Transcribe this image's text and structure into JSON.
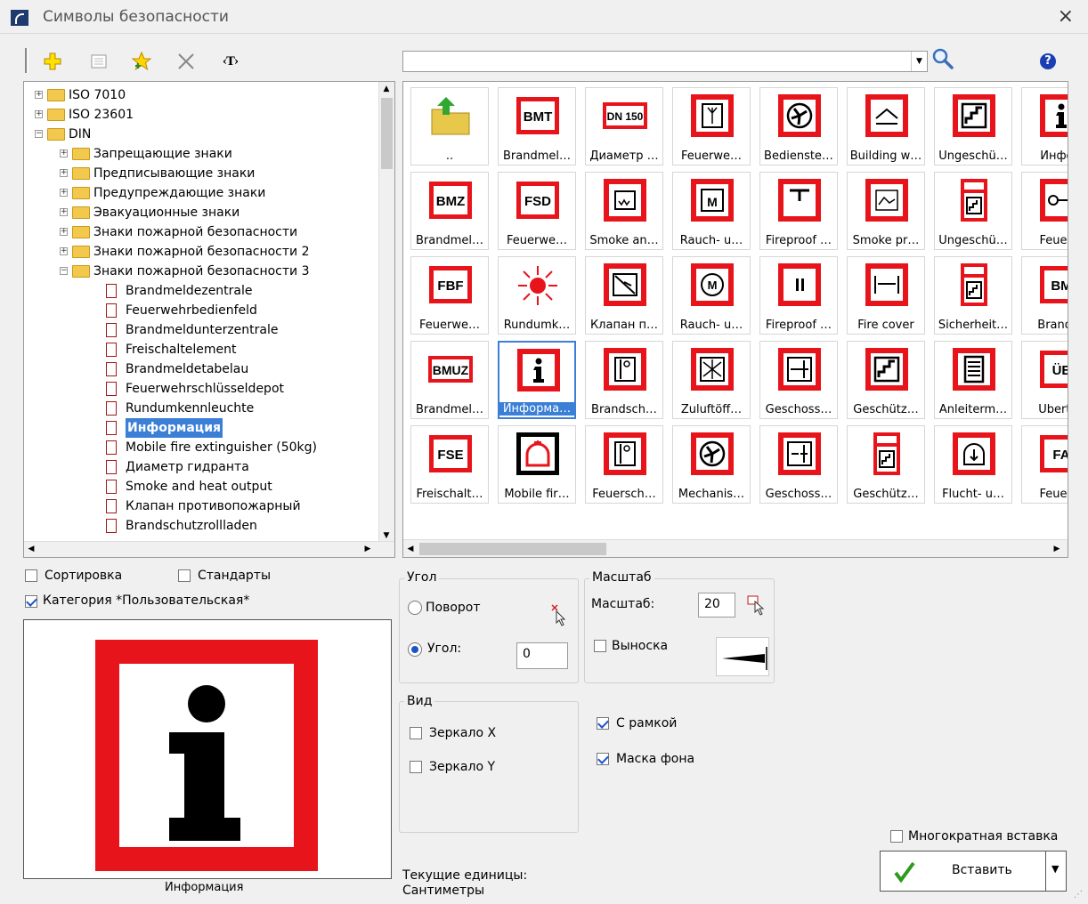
{
  "window": {
    "title": "Символы безопасности",
    "close": "×"
  },
  "toolbar": {
    "text_label": "‹T›",
    "search_value": "",
    "help": "?"
  },
  "tree": {
    "rows": [
      {
        "label": "ISO 7010",
        "expander": "+",
        "type": "folder",
        "level": 0
      },
      {
        "label": "ISO 23601",
        "expander": "+",
        "type": "folder",
        "level": 0
      },
      {
        "label": "DIN",
        "expander": "−",
        "type": "folder",
        "level": 0
      },
      {
        "label": "Запрещающие знаки",
        "expander": "+",
        "type": "folder",
        "level": 1
      },
      {
        "label": "Предписывающие знаки",
        "expander": "+",
        "type": "folder",
        "level": 1
      },
      {
        "label": "Предупреждающие знаки",
        "expander": "+",
        "type": "folder",
        "level": 1
      },
      {
        "label": "Эвакуационные знаки",
        "expander": "+",
        "type": "folder",
        "level": 1
      },
      {
        "label": "Знаки пожарной безопасности",
        "expander": "+",
        "type": "folder",
        "level": 1
      },
      {
        "label": "Знаки пожарной безопасности 2",
        "expander": "+",
        "type": "folder",
        "level": 1
      },
      {
        "label": "Знаки пожарной безопасности 3",
        "expander": "−",
        "type": "folder",
        "level": 1
      },
      {
        "label": "Brandmeldezentrale",
        "type": "doc",
        "level": 2
      },
      {
        "label": "Feuerwehrbedienfeld",
        "type": "doc",
        "level": 2
      },
      {
        "label": "Brandmeldunterzentrale",
        "type": "doc",
        "level": 2
      },
      {
        "label": "Freischaltelement",
        "type": "doc",
        "level": 2
      },
      {
        "label": "Brandmeldetabelau",
        "type": "doc",
        "level": 2
      },
      {
        "label": "Feuerwehrschlüsseldepot",
        "type": "doc",
        "level": 2
      },
      {
        "label": "Rundumkennleuchte",
        "type": "doc",
        "level": 2
      },
      {
        "label": "Информация",
        "type": "doc",
        "level": 2,
        "selected": true
      },
      {
        "label": "Mobile fire extinguisher (50kg)",
        "type": "doc",
        "level": 2
      },
      {
        "label": "Диаметр гидранта",
        "type": "doc",
        "level": 2
      },
      {
        "label": "Smoke and heat output",
        "type": "doc",
        "level": 2
      },
      {
        "label": "Клапан противопожарный",
        "type": "doc",
        "level": 2
      },
      {
        "label": "Brandschutzrollladen",
        "type": "doc",
        "level": 2
      }
    ]
  },
  "grid": {
    "rows": [
      [
        {
          "caption": "..",
          "glyph": "up-folder"
        },
        {
          "caption": "Brandmel…",
          "glyph": "BMT"
        },
        {
          "caption": "Диаметр …",
          "glyph": "DN 150"
        },
        {
          "caption": "Feuerwe…",
          "glyph": "antenna"
        },
        {
          "caption": "Bedienste…",
          "glyph": "fan"
        },
        {
          "caption": "Building w…",
          "glyph": "roof"
        },
        {
          "caption": "Ungeschü…",
          "glyph": "stairs"
        },
        {
          "caption": "Инфор",
          "glyph": "i"
        }
      ],
      [
        {
          "caption": "Brandmel…",
          "glyph": "BMZ"
        },
        {
          "caption": "Feuerwe…",
          "glyph": "FSD"
        },
        {
          "caption": "Smoke an…",
          "glyph": "smoke"
        },
        {
          "caption": "Rauch- u…",
          "glyph": "M"
        },
        {
          "caption": "Fireproof …",
          "glyph": "T"
        },
        {
          "caption": "Smoke pr…",
          "glyph": "wave"
        },
        {
          "caption": "Ungeschü…",
          "glyph": "stairs-tall"
        },
        {
          "caption": "Feuerw",
          "glyph": "key"
        }
      ],
      [
        {
          "caption": "Feuerwe…",
          "glyph": "FBF"
        },
        {
          "caption": "Rundumk…",
          "glyph": "beacon"
        },
        {
          "caption": "Клапан п…",
          "glyph": "damper"
        },
        {
          "caption": "Rauch- u…",
          "glyph": "M-circle"
        },
        {
          "caption": "Fireproof …",
          "glyph": "II"
        },
        {
          "caption": "Fire cover",
          "glyph": "cover"
        },
        {
          "caption": "Sicherheit…",
          "glyph": "stairs-tall"
        },
        {
          "caption": "Brandm",
          "glyph": "BM"
        }
      ],
      [
        {
          "caption": "Brandmel…",
          "glyph": "BMUZ"
        },
        {
          "caption": "Информа…",
          "glyph": "i",
          "selected": true
        },
        {
          "caption": "Brandsch…",
          "glyph": "door"
        },
        {
          "caption": "Zuluftöff…",
          "glyph": "vent"
        },
        {
          "caption": "Geschoss…",
          "glyph": "floor"
        },
        {
          "caption": "Geschütz…",
          "glyph": "stairs"
        },
        {
          "caption": "Anleiterm…",
          "glyph": "ladder"
        },
        {
          "caption": "Übertra",
          "glyph": "ÜE"
        }
      ],
      [
        {
          "caption": "Freischalt…",
          "glyph": "FSE"
        },
        {
          "caption": "Mobile fir…",
          "glyph": "extinguisher"
        },
        {
          "caption": "Feuersch…",
          "glyph": "door"
        },
        {
          "caption": "Mechanis…",
          "glyph": "fan"
        },
        {
          "caption": "Geschoss…",
          "glyph": "floor2"
        },
        {
          "caption": "Geschütz…",
          "glyph": "stairs-tall"
        },
        {
          "caption": "Flucht- u…",
          "glyph": "exit"
        },
        {
          "caption": "Feuerw",
          "glyph": "FA"
        }
      ]
    ]
  },
  "options": {
    "sort_label": "Сортировка",
    "sort_checked": false,
    "standards_label": "Стандарты",
    "standards_checked": false,
    "category_label": "Категория *Пользовательская*",
    "category_checked": true
  },
  "preview": {
    "caption": "Информация"
  },
  "angle": {
    "group_title": "Угол",
    "rotate_label": "Поворот",
    "angle_label": "Угол:",
    "angle_value": "0",
    "mode": "angle"
  },
  "scale": {
    "group_title": "Масштаб",
    "scale_label": "Масштаб:",
    "scale_value": "20",
    "leader_label": "Выноска",
    "leader_checked": false
  },
  "view": {
    "group_title": "Вид",
    "mirror_x_label": "Зеркало X",
    "mirror_x_checked": false,
    "mirror_y_label": "Зеркало Y",
    "mirror_y_checked": false
  },
  "frame": {
    "label": "С рамкой",
    "checked": true
  },
  "mask": {
    "label": "Маска фона",
    "checked": true
  },
  "multi_insert": {
    "label": "Многократная вставка",
    "checked": false
  },
  "units": {
    "label": "Текущие единицы:",
    "value": "Сантиметры"
  },
  "insert_button": {
    "label": "Вставить"
  },
  "colors": {
    "sign_red": "#e8141b",
    "selection": "#3b7fd6",
    "check": "#1b55c8"
  }
}
